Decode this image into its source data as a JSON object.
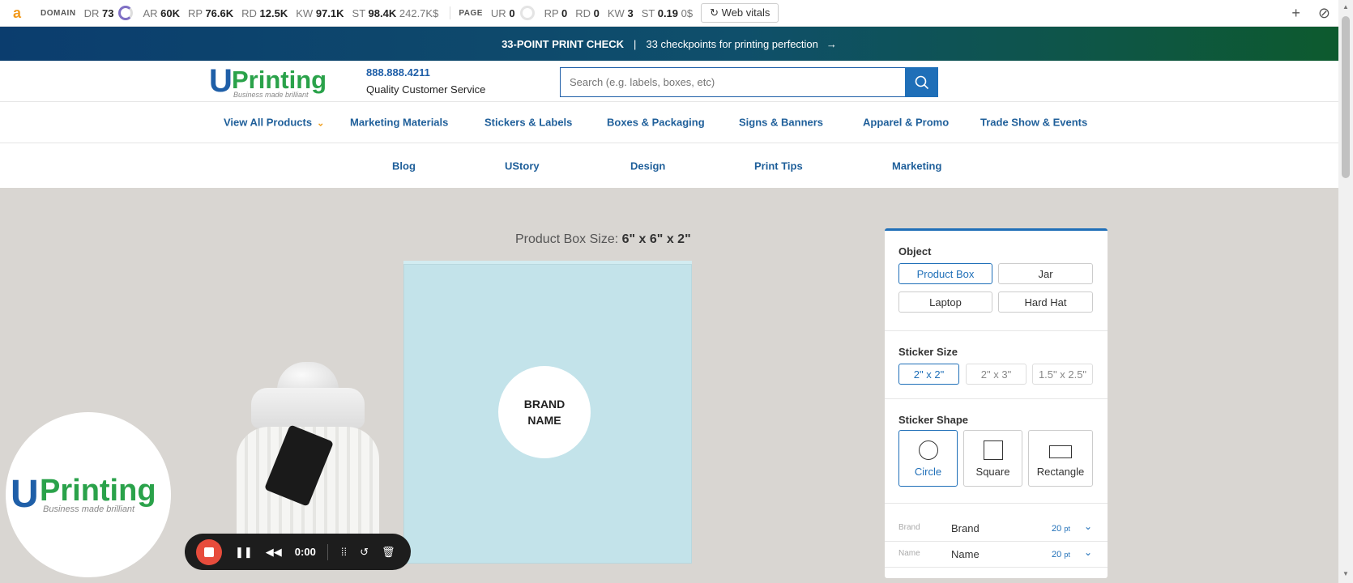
{
  "seo_bar": {
    "logo": "a",
    "domain_label": "DOMAIN",
    "domain_metrics": [
      {
        "key": "DR",
        "value": "73"
      },
      {
        "key": "AR",
        "value": "60K"
      },
      {
        "key": "RP",
        "value": "76.6K"
      },
      {
        "key": "RD",
        "value": "12.5K"
      },
      {
        "key": "KW",
        "value": "97.1K"
      },
      {
        "key": "ST",
        "value": "98.4K"
      }
    ],
    "domain_traffic_value": "242.7K$",
    "page_label": "PAGE",
    "page_metrics": [
      {
        "key": "UR",
        "value": "0"
      },
      {
        "key": "RP",
        "value": "0"
      },
      {
        "key": "RD",
        "value": "0"
      },
      {
        "key": "KW",
        "value": "3"
      },
      {
        "key": "ST",
        "value": "0.19"
      }
    ],
    "page_traffic_value": "0$",
    "web_vitals_label": "Web vitals"
  },
  "promo": {
    "headline": "33-POINT PRINT CHECK",
    "separator": "|",
    "text": "33 checkpoints for printing perfection",
    "arrow": "→"
  },
  "header": {
    "logo_u": "U",
    "logo_printing": "Printing",
    "logo_tagline": "Business made brilliant",
    "phone": "888.888.4211",
    "service_label": "Quality Customer Service",
    "search_placeholder": "Search (e.g. labels, boxes, etc)"
  },
  "nav": {
    "items": [
      "View All Products",
      "Marketing Materials",
      "Stickers & Labels",
      "Boxes & Packaging",
      "Signs & Banners",
      "Apparel & Promo",
      "Trade Show & Events"
    ],
    "chevron": "⌄"
  },
  "nav2": {
    "items": [
      "Blog",
      "UStory",
      "Design",
      "Print Tips",
      "Marketing"
    ]
  },
  "hero": {
    "size_label": "Product Box Size:",
    "size_value": "6\" x 6\" x 2\"",
    "brand_line1": "BRAND",
    "brand_line2": "NAME"
  },
  "panel": {
    "object_heading": "Object",
    "object_options": [
      "Product Box",
      "Jar",
      "Laptop",
      "Hard Hat"
    ],
    "size_heading": "Sticker Size",
    "size_options": [
      "2\" x 2\"",
      "2\" x 3\"",
      "1.5\" x 2.5\""
    ],
    "shape_heading": "Sticker Shape",
    "shape_options": [
      "Circle",
      "Square",
      "Rectangle"
    ],
    "fields": [
      {
        "label": "Brand",
        "value": "Brand",
        "size": "20",
        "unit": "pt"
      },
      {
        "label": "Name",
        "value": "Name",
        "size": "20",
        "unit": "pt"
      }
    ]
  },
  "recorder": {
    "time": "0:00"
  },
  "colors": {
    "brand_blue": "#1f5fa8",
    "brand_green": "#2aa24a",
    "accent_orange": "#f0a020",
    "record_red": "#e74c3c",
    "box_blue": "#c3e3ea"
  }
}
